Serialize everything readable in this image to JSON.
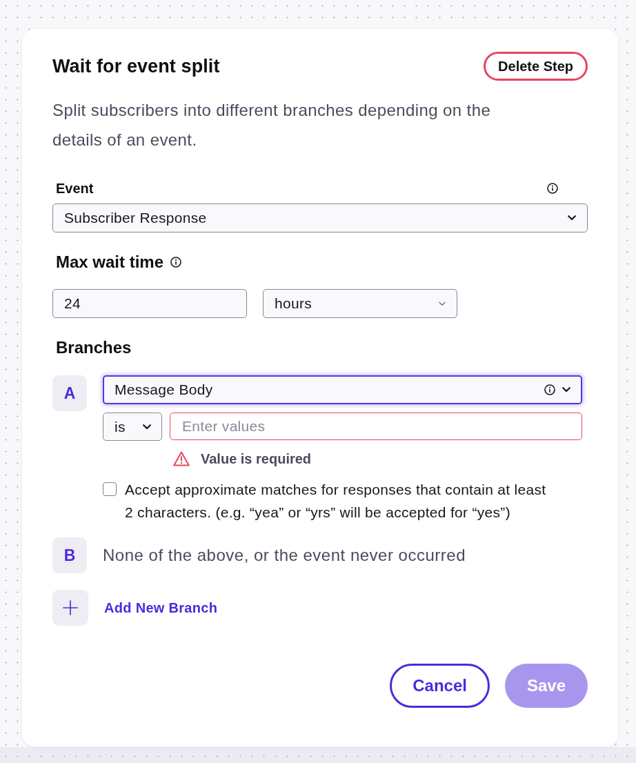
{
  "dialog": {
    "title": "Wait for event split",
    "delete_button": "Delete Step",
    "description": "Split subscribers into different branches depending on the details of an event."
  },
  "event": {
    "label": "Event",
    "value": "Subscriber Response"
  },
  "max_wait_time": {
    "label": "Max wait time",
    "amount": "24",
    "unit": "hours"
  },
  "branches": {
    "heading": "Branches",
    "items": [
      {
        "kind": "condition",
        "letter": "A",
        "field": {
          "value": "Message Body",
          "focused": true
        },
        "operator": "is",
        "values": {
          "placeholder": "Enter values",
          "invalid": true
        },
        "error": "Value is required",
        "approximate_match": {
          "label": "Accept approximate matches for responses that contain at least 2 characters. (e.g. “yea” or “yrs” will be accepted for “yes”)",
          "checked": false
        }
      },
      {
        "kind": "fallback",
        "letter": "B",
        "text": "None of the above, or the event never occurred"
      }
    ],
    "add_button": "Add New Branch"
  },
  "footer": {
    "buttons": [
      {
        "label": "Cancel",
        "kind": "secondary",
        "disabled": false
      },
      {
        "label": "Save",
        "kind": "primary",
        "disabled": true
      }
    ]
  }
}
